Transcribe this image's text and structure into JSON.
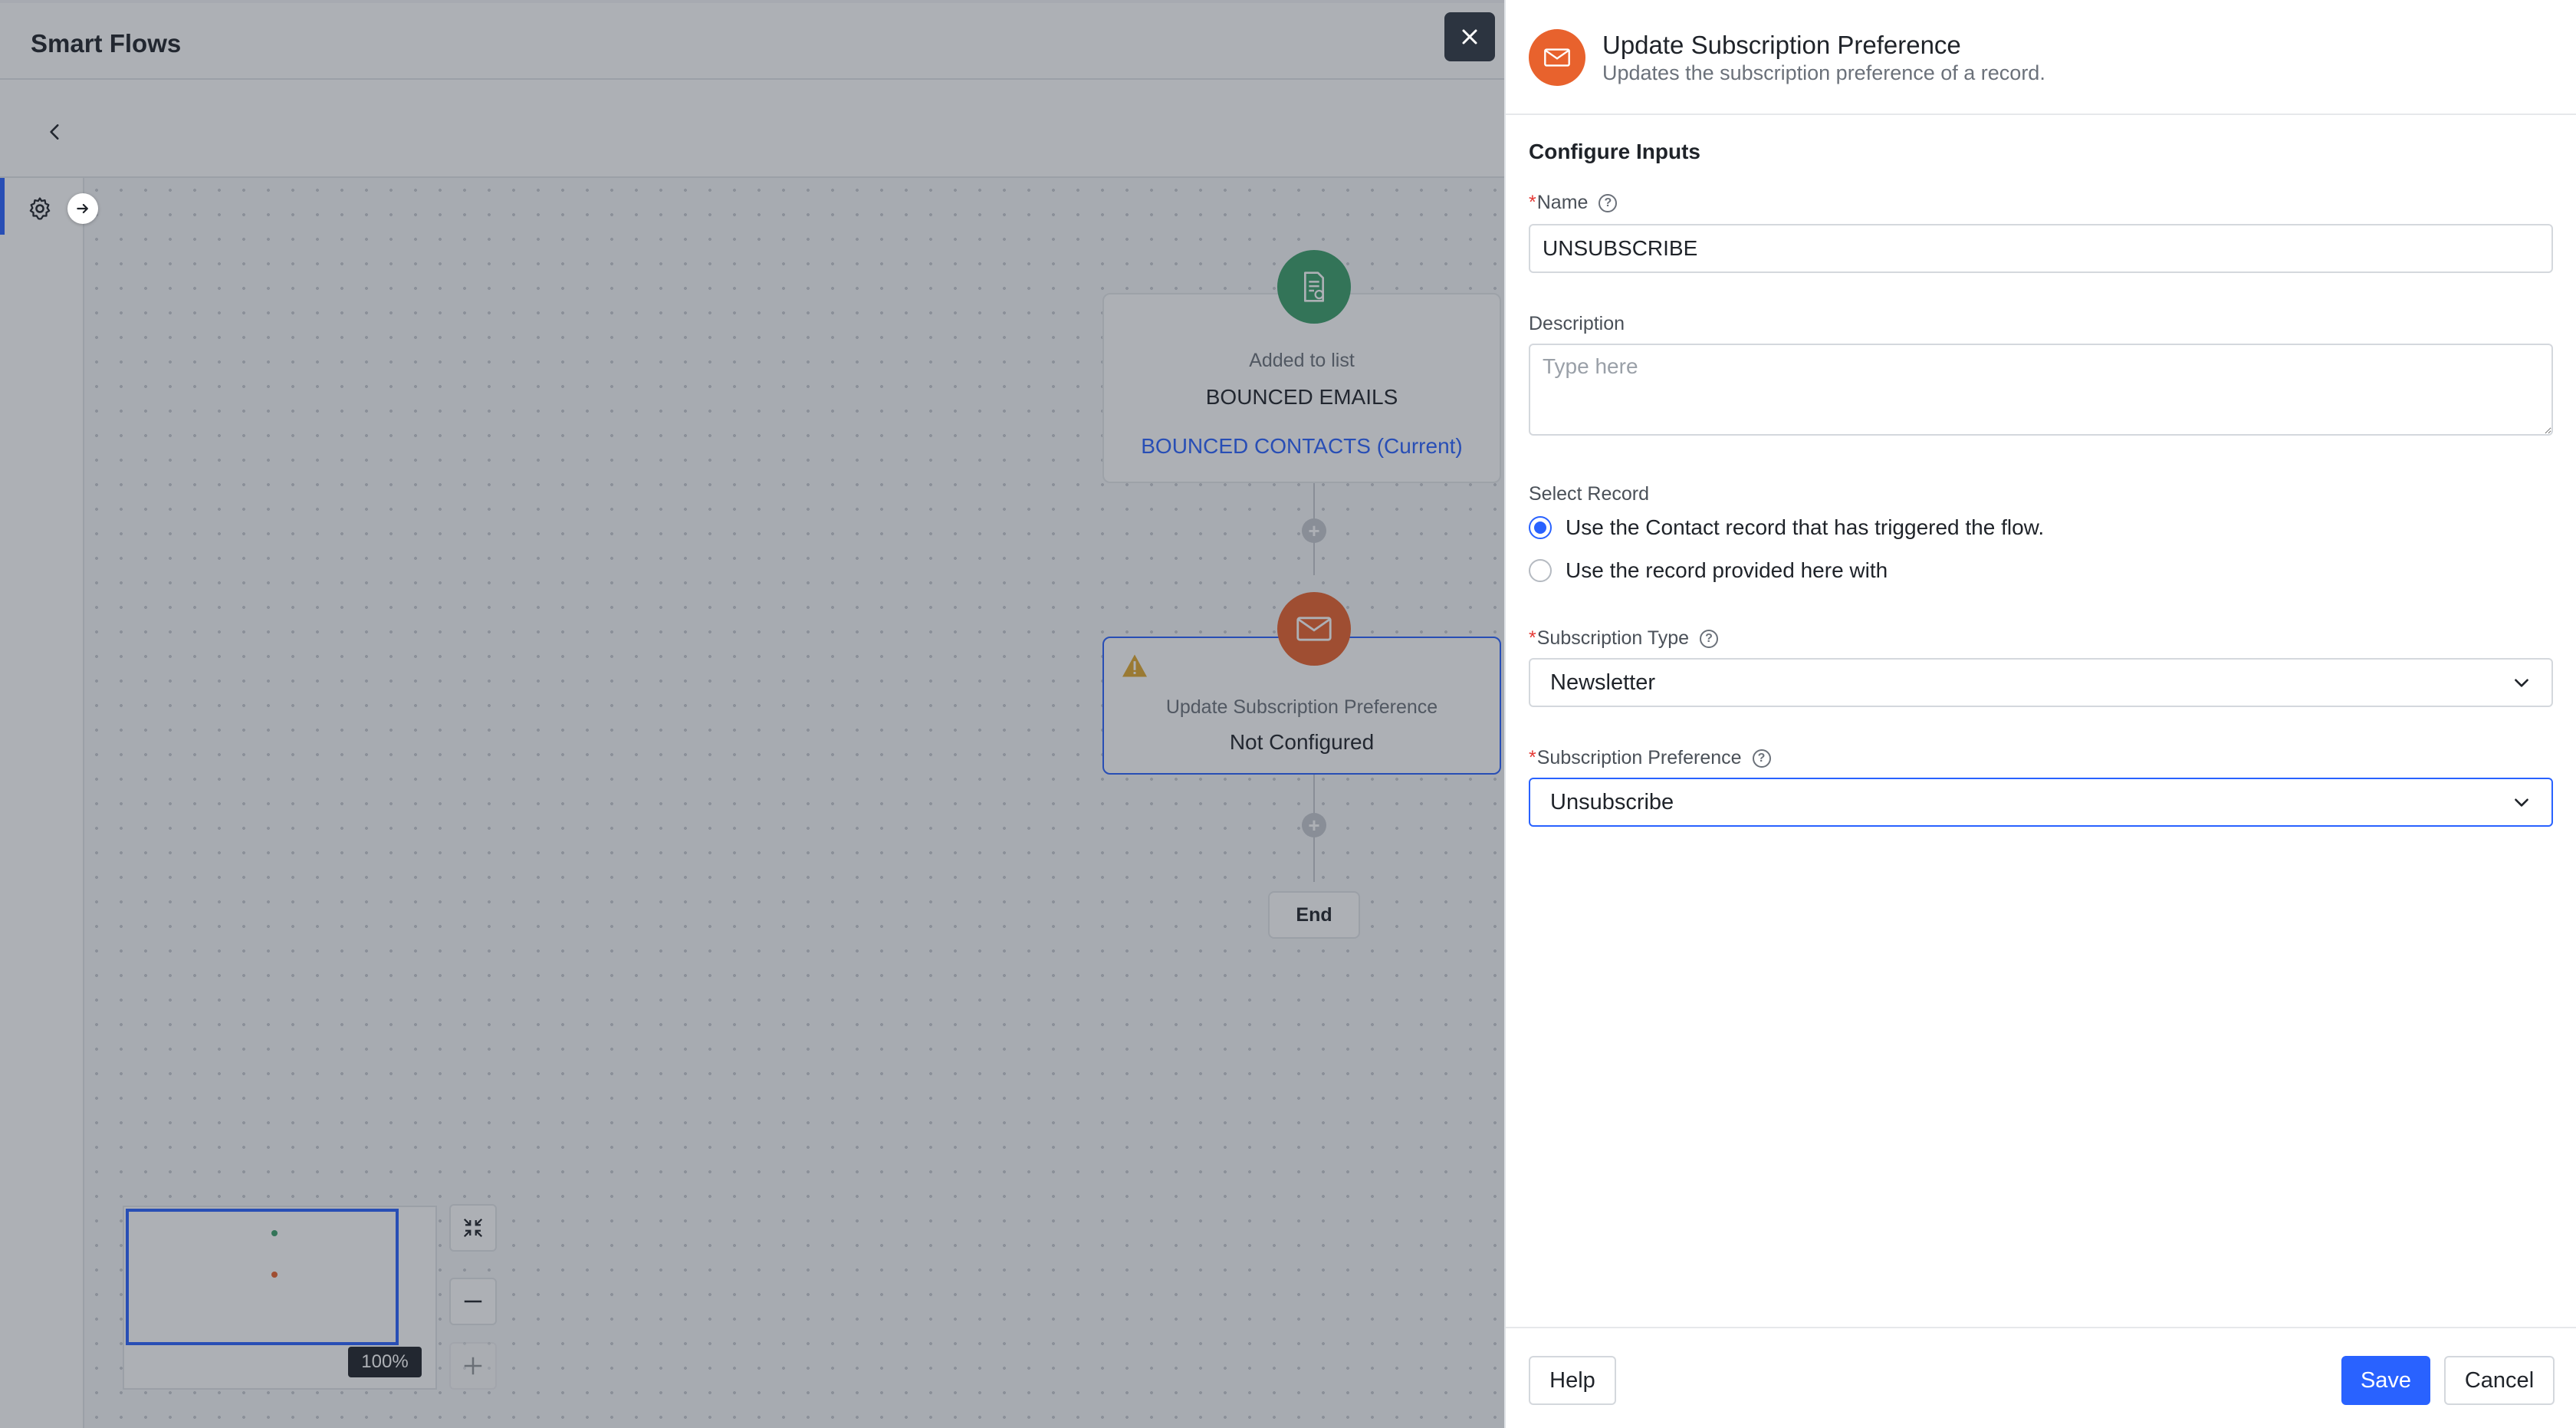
{
  "app": {
    "title": "Smart Flows"
  },
  "flow": {
    "trigger_node": {
      "label": "Added to list",
      "title": "BOUNCED EMAILS",
      "link": "BOUNCED CONTACTS (Current)",
      "color": "#3a9e6a"
    },
    "action_node": {
      "label": "Update Subscription Preference",
      "status": "Not Configured",
      "color": "#e8622d"
    },
    "end_label": "End"
  },
  "minimap": {
    "zoom": "100%"
  },
  "panel": {
    "title": "Update Subscription Preference",
    "subtitle": "Updates the subscription preference of a record.",
    "section_title": "Configure Inputs",
    "name": {
      "label": "Name",
      "value": "UNSUBSCRIBE"
    },
    "description": {
      "label": "Description",
      "placeholder": "Type here"
    },
    "select_record": {
      "label": "Select Record",
      "options": [
        {
          "label": "Use the Contact record that has triggered the flow.",
          "selected": true
        },
        {
          "label": "Use the record provided here with",
          "selected": false
        }
      ]
    },
    "subscription_type": {
      "label": "Subscription Type",
      "value": "Newsletter"
    },
    "subscription_preference": {
      "label": "Subscription Preference",
      "value": "Unsubscribe"
    },
    "footer": {
      "help_label": "Help",
      "save_label": "Save",
      "cancel_label": "Cancel"
    }
  },
  "colors": {
    "accent": "#2962ff",
    "required": "#e53935"
  }
}
